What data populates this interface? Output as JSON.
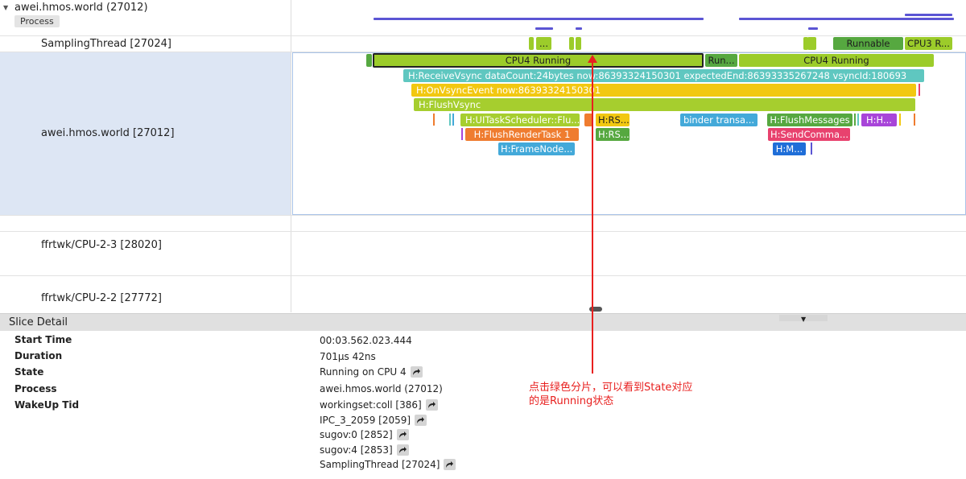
{
  "process": {
    "name": "awei.hmos.world (27012)",
    "tag": "Process"
  },
  "threads": [
    {
      "name": "SamplingThread [27024]"
    },
    {
      "name": "awei.hmos.world [27012]"
    },
    {
      "name": "ffrtwk/CPU-2-3 [28020]"
    },
    {
      "name": "ffrtwk/CPU-2-2 [27772]"
    }
  ],
  "slices": {
    "sampling": {
      "s1": "...",
      "runnable": "Runnable",
      "cpu3": "CPU3 R..."
    },
    "main": {
      "cpu4_selected": "CPU4 Running",
      "run_short": "Run...",
      "cpu4_b": "CPU4 Running",
      "receive_vsync": "H:ReceiveVsync dataCount:24bytes now:86393324150301 expectedEnd:86393335267248 vsyncId:180693",
      "on_vsync": "H:OnVsyncEvent now:86393324150301",
      "flush_vsync": "H:FlushVsync",
      "ui_task": "H:UITaskScheduler::Flu...",
      "rs_a": "H:RS...",
      "rs_b": "H:RS...",
      "binder": "binder transa...",
      "flush_messages": "H:FlushMessages",
      "h_h": "H:H...",
      "flush_render": "H:FlushRenderTask 1",
      "send_command": "H:SendComma...",
      "frame_node": "H:FrameNode...",
      "h_m": "H:M..."
    }
  },
  "colors": {
    "green_running": "#9ccc2a",
    "green_dark": "#56a840",
    "teal": "#5fc7c0",
    "yellow": "#f2c811",
    "lime": "#a6ce2e",
    "orange": "#ef7c2f",
    "blue": "#43a9d9",
    "pink": "#e8426e",
    "purple": "#a845d9",
    "royal": "#1f6ed8",
    "annotation": "#e8201f"
  },
  "detail": {
    "title": "Slice Detail",
    "rows": [
      {
        "key": "Start Time",
        "value": "00:03.562.023.444"
      },
      {
        "key": "Duration",
        "value": "701μs 42ns"
      },
      {
        "key": "State",
        "value": "Running on CPU 4"
      },
      {
        "key": "Process",
        "value": "awei.hmos.world (27012)"
      },
      {
        "key": "WakeUp Tid",
        "value": "workingset:coll [386]"
      }
    ],
    "wakeup_extra": [
      "IPC_3_2059 [2059]",
      "sugov:0 [2852]",
      "sugov:4 [2853]",
      "SamplingThread [27024]"
    ]
  },
  "annotation": {
    "line1": "点击绿色分片，可以看到State对应",
    "line2": "的是Running状态"
  }
}
